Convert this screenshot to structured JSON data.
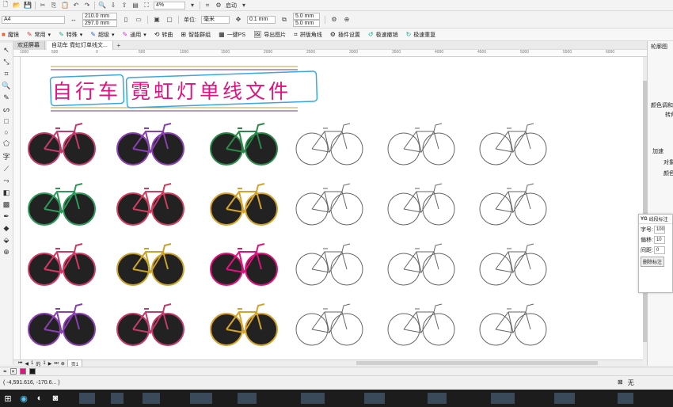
{
  "toolbar": {
    "zoom_value": "4%",
    "mode_label": "启动",
    "paper_size": "A4",
    "width_value": "210.0 mm",
    "height_value": "297.0 mm",
    "units_label": "单位:",
    "units_value": "毫米",
    "nudge_value": "0.1 mm",
    "dup_x_value": "5.0 mm",
    "dup_y_value": "5.0 mm"
  },
  "plugin_bar": {
    "items": [
      {
        "label": "魔镜",
        "icon": "mirror-icon"
      },
      {
        "label": "常用",
        "icon": "common-icon"
      },
      {
        "label": "特殊",
        "icon": "special-icon"
      },
      {
        "label": "超级",
        "icon": "super-icon"
      },
      {
        "label": "通用",
        "icon": "general-icon"
      },
      {
        "label": "转曲",
        "icon": "convert-icon"
      },
      {
        "label": "智能群组",
        "icon": "group-icon"
      },
      {
        "label": "一键PS",
        "icon": "ps-icon"
      },
      {
        "label": "导出图片",
        "icon": "export-icon"
      },
      {
        "label": "拼版角线",
        "icon": "cropmark-icon"
      },
      {
        "label": "插件设置",
        "icon": "settings-icon"
      },
      {
        "label": "极速撤销",
        "icon": "undo-icon"
      },
      {
        "label": "极速重复",
        "icon": "redo-icon"
      }
    ]
  },
  "tabs": [
    {
      "label": "欢迎屏幕"
    },
    {
      "label": "自动车 霓虹灯单线文..."
    }
  ],
  "ruler": {
    "ticks": [
      "1000",
      "500",
      "0",
      "500",
      "1000",
      "1500",
      "2000",
      "2500",
      "3000",
      "3500",
      "4000",
      "4500",
      "5000",
      "5500",
      "6000"
    ]
  },
  "canvas": {
    "title": "自行车 霓虹灯单线文件",
    "title_color": "#e0127f",
    "box_color": "#39a7e0"
  },
  "right_docker": {
    "header": "轮廓图",
    "labels": [
      "转角",
      "颜色调和",
      "加速",
      "对象",
      "颜色"
    ]
  },
  "line_mark_panel": {
    "title": "线段标注",
    "logo": "YG",
    "rows": [
      {
        "label": "字号:",
        "value": "100"
      },
      {
        "label": "偏移:",
        "value": "10"
      },
      {
        "label": "间距:",
        "value": "0"
      }
    ],
    "button": "删除标注"
  },
  "page_nav": {
    "current": "1",
    "of_label": "的",
    "total": "1",
    "page_tab": "页1"
  },
  "status": {
    "coords": "( -4,591.616, -170.6... )",
    "fill_label": "无"
  },
  "colors": {
    "outline": "#1a1a1a",
    "fill_swatch": "#e0127f"
  }
}
